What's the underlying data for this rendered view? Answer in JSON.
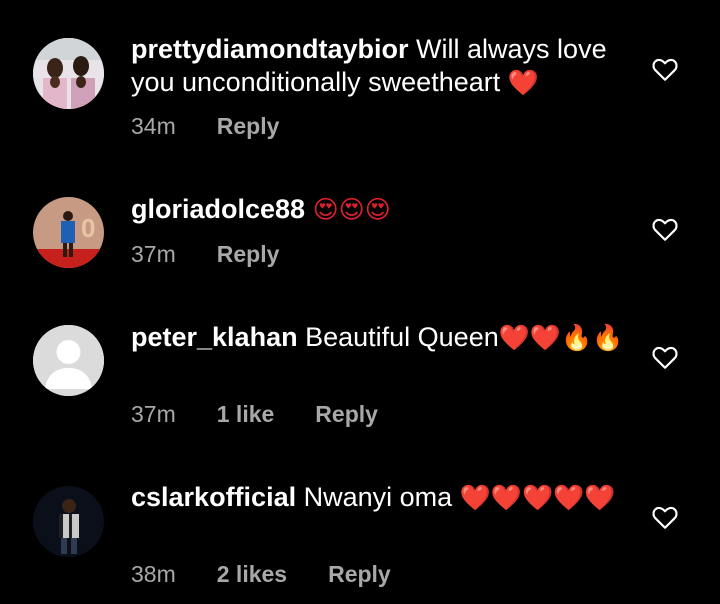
{
  "comments": [
    {
      "username": "prettydiamondtaybior",
      "text": "Will always love you unconditionally sweetheart",
      "emoji": "❤️",
      "time": "34m",
      "likes": "",
      "reply": "Reply"
    },
    {
      "username": "gloriadolce88",
      "text": "",
      "emoji": "😍😍😍",
      "time": "37m",
      "likes": "",
      "reply": "Reply"
    },
    {
      "username": "peter_klahan",
      "text": "Beautiful Queen",
      "emoji": "❤️❤️🔥🔥",
      "time": "37m",
      "likes": "1 like",
      "reply": "Reply"
    },
    {
      "username": "cslarkofficial",
      "text": "Nwanyi oma",
      "emoji": "❤️❤️❤️❤️❤️",
      "time": "38m",
      "likes": "2 likes",
      "reply": "Reply"
    }
  ],
  "icons": {
    "like": "heart-outline-icon"
  },
  "colors": {
    "background": "#000000",
    "meta": "#a8a8a8",
    "heart_emoji": "#e0202e"
  }
}
